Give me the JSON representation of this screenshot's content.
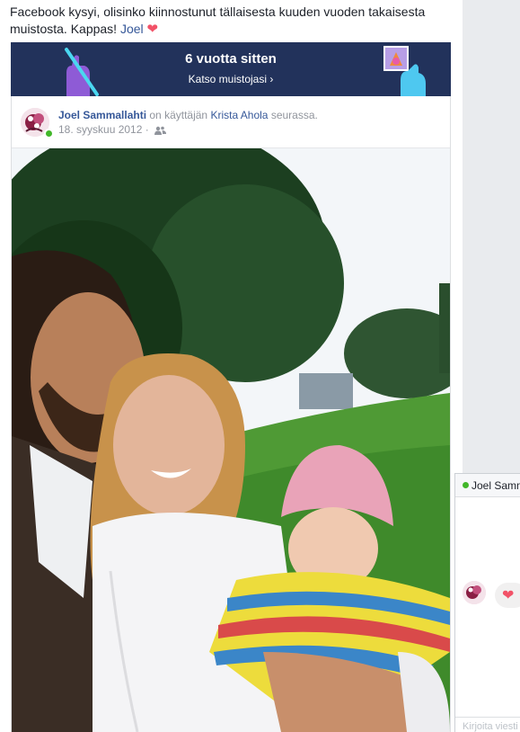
{
  "intro": {
    "text": "Facebook kysyi, olisinko kiinnostunut tällaisesta kuuden vuoden takaisesta muistosta. Kappas! ",
    "mention": "Joel",
    "heart": "❤"
  },
  "banner": {
    "title": "6 vuotta sitten",
    "subtitle": "Katso muistojasi ›"
  },
  "post": {
    "author": "Joel Sammallahti",
    "with_text": " on käyttäjän ",
    "tagged": "Krista Ahola",
    "with_suffix": " seurassa.",
    "date": "18. syyskuu 2012 ·",
    "audience_icon": "friends-icon"
  },
  "chat": {
    "name": "Joel Samm",
    "heart": "❤",
    "input_placeholder": "Kirjoita viesti"
  },
  "colors": {
    "banner_bg": "#22325b",
    "link": "#365899",
    "heart": "#f25268",
    "online": "#42b72a"
  }
}
